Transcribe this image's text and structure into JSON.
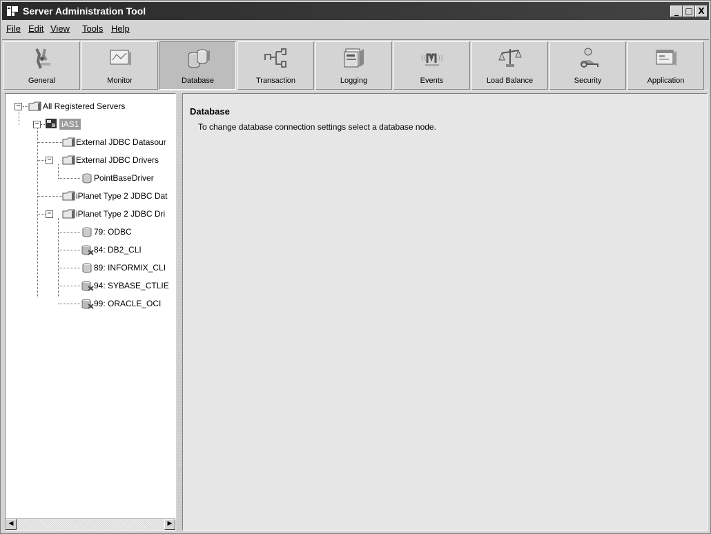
{
  "window": {
    "title": "Server Administration Tool",
    "controls": {
      "minimize": "_",
      "maximize": "□",
      "close": "X"
    }
  },
  "menu": [
    {
      "label": "File",
      "mnemonic_index": 0
    },
    {
      "label": "Edit",
      "mnemonic_index": 0
    },
    {
      "label": "View",
      "mnemonic_index": 0
    },
    {
      "label": "Tools",
      "mnemonic_index": 0
    },
    {
      "label": "Help",
      "mnemonic_index": 0
    }
  ],
  "toolbar": {
    "active": "Database",
    "buttons": [
      {
        "label": "General",
        "icon": "general-icon"
      },
      {
        "label": "Monitor",
        "icon": "monitor-icon"
      },
      {
        "label": "Database",
        "icon": "database-icon"
      },
      {
        "label": "Transaction",
        "icon": "transaction-icon"
      },
      {
        "label": "Logging",
        "icon": "logging-icon"
      },
      {
        "label": "Events",
        "icon": "events-icon"
      },
      {
        "label": "Load Balance",
        "icon": "load-balance-icon"
      },
      {
        "label": "Security",
        "icon": "security-icon"
      },
      {
        "label": "Application",
        "icon": "application-icon"
      }
    ]
  },
  "tree": {
    "root": "All Registered Servers",
    "server": "iAS1",
    "nodes": [
      {
        "label": "External JDBC Datasour",
        "icon": "folder-icon"
      },
      {
        "label": "External JDBC Drivers",
        "icon": "folder-icon"
      },
      {
        "label": "PointBaseDriver",
        "icon": "database-node-icon"
      },
      {
        "label": "iPlanet Type 2 JDBC Dat",
        "icon": "folder-icon"
      },
      {
        "label": "iPlanet Type 2 JDBC Dri",
        "icon": "folder-icon"
      },
      {
        "label": "79: ODBC",
        "icon": "database-node-icon"
      },
      {
        "label": "84: DB2_CLI",
        "icon": "database-disabled-icon"
      },
      {
        "label": "89: INFORMIX_CLI",
        "icon": "database-node-icon"
      },
      {
        "label": "94: SYBASE_CTLIE",
        "icon": "database-disabled-icon"
      },
      {
        "label": "99: ORACLE_OCI",
        "icon": "database-disabled-icon"
      }
    ]
  },
  "content": {
    "title": "Database",
    "description": "To change database connection settings select a database node."
  },
  "scrollbar": {
    "left_arrow": "◀",
    "right_arrow": "▶"
  }
}
